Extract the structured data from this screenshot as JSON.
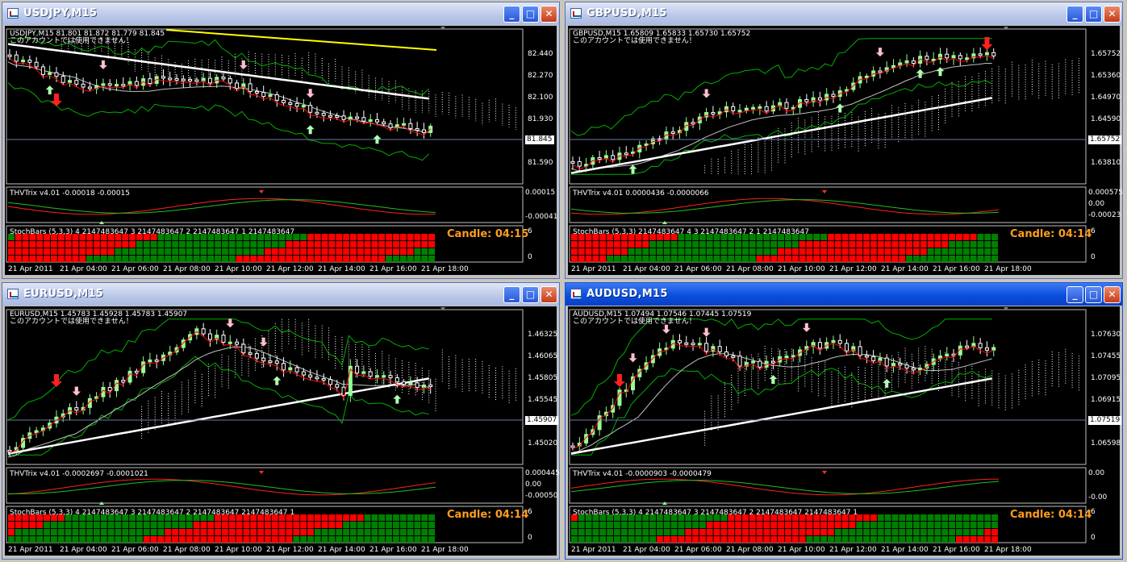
{
  "windows": [
    {
      "title": "USDJPY,M15",
      "active": false,
      "legend": "USDJPY,M15  81.801 81.872 81.779 81.845",
      "notice": "このアカウントでは使用できません！",
      "prices": [
        "82.440",
        "82.270",
        "82.100",
        "81.930",
        "81.760",
        "81.590"
      ],
      "current_price": "81.845",
      "trix_label": "THVTrix v4.01 -0.00018 -0.00015",
      "trix_scale": [
        "0.00015",
        "-0.00041"
      ],
      "stoch_label": "StochBars (5,3,3) 4 2147483647 3 2147483647 2 2147483647 1 2147483647",
      "stoch_scale": [
        "6",
        "0"
      ],
      "candle_label": "Candle:  04:15",
      "trend": "down",
      "cloud": "above"
    },
    {
      "title": "GBPUSD,M15",
      "active": false,
      "legend": "GBPUSD,M15  1.65809 1.65833 1.65730 1.65752",
      "notice": "このアカウントでは使用できません！",
      "prices": [
        "1.65752",
        "1.65360",
        "1.64970",
        "1.64590",
        "1.64200",
        "1.63810"
      ],
      "current_price": "1.65752",
      "trix_label": "THVTrix v4.01 0.0000436 -0.0000066",
      "trix_scale": [
        "0.000575",
        "0.00",
        "-0.00023"
      ],
      "stoch_label": "StochBars (5,3,3) 2147483647 4 3 2147483647 2 1 2147483647",
      "stoch_scale": [
        "6",
        "0"
      ],
      "candle_label": "Candle:  04:14",
      "trend": "up",
      "cloud": "below"
    },
    {
      "title": "EURUSD,M15",
      "active": false,
      "legend": "EURUSD,M15  1.45783 1.45928 1.45783 1.45907",
      "notice": "このアカウントでは使用できません！",
      "prices": [
        "1.46325",
        "1.46065",
        "1.45805",
        "1.45545",
        "1.45280",
        "1.45020"
      ],
      "current_price": "1.45907",
      "trix_label": "THVTrix v4.01 -0.0002697 -0.0001021",
      "trix_scale": [
        "0.000445",
        "0.00",
        "-0.00050"
      ],
      "stoch_label": "StochBars (5,3,3) 4 2147483647 3 2147483647 2 2147483647 2147483647 1",
      "stoch_scale": [
        "6",
        "0"
      ],
      "candle_label": "Candle:  04:14",
      "trend": "updown",
      "cloud": "right"
    },
    {
      "title": "AUDUSD,M15",
      "active": true,
      "legend": "AUDUSD,M15  1.07494 1.07546 1.07445 1.07519",
      "notice": "このアカウントでは使用できません！",
      "prices": [
        "1.07630",
        "1.07455",
        "1.07095",
        "1.06915",
        "1.06740",
        "1.06598"
      ],
      "current_price": "1.07519",
      "trix_label": "THVTrix v4.01 -0.0000903 -0.0000479",
      "trix_scale": [
        "0.00",
        "-0.00"
      ],
      "stoch_label": "StochBars (5,3,3) 4 2147483647 3 2147483647 2 2147483647 2147483647 1",
      "stoch_scale": [
        "6",
        "0"
      ],
      "candle_label": "Candle:  04:14",
      "trend": "upflat",
      "cloud": "below"
    }
  ],
  "time_labels": [
    "21 Apr 2011",
    "21 Apr 04:00",
    "21 Apr 06:00",
    "21 Apr 08:00",
    "21 Apr 10:00",
    "21 Apr 12:00",
    "21 Apr 14:00",
    "21 Apr 16:00",
    "21 Apr 18:00"
  ],
  "colors": {
    "bull_candle": "#98fb98",
    "bear_candle": "#ffffff",
    "ma_fast": "#ff0000",
    "ma_slow": "#c0c0c0",
    "ma_long": "#ffffff",
    "envelope": "#00b000",
    "sma200": "#ffff00",
    "stoch_green": "#008000",
    "stoch_red": "#ff0000",
    "candle_text": "#ff9d1e",
    "window_frame": "#c0c0c0",
    "active_title": "#0a4fe0"
  },
  "buttons": {
    "minimize": "_",
    "maximize": "□",
    "close": "✕"
  }
}
